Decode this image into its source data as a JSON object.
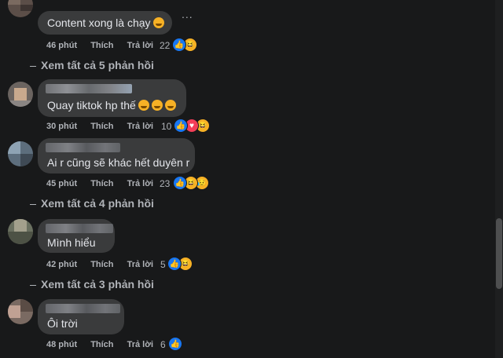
{
  "comments": [
    {
      "text": "Content xong là chạy",
      "emoji": "sweat-smile",
      "time": "46 phút",
      "like": "Thích",
      "reply": "Trả lời",
      "reactions_count": "22",
      "reactions": [
        "like",
        "haha"
      ]
    },
    {
      "text": "Quay tiktok hp thế",
      "emoji": "rofl x3",
      "time": "30 phút",
      "like": "Thích",
      "reply": "Trả lời",
      "reactions_count": "10",
      "reactions": [
        "like",
        "love",
        "haha"
      ]
    },
    {
      "text": "Ai r cũng sẽ khác hết duyên r",
      "time": "45 phút",
      "like": "Thích",
      "reply": "Trả lời",
      "reactions_count": "23",
      "reactions": [
        "like",
        "haha",
        "sad"
      ]
    },
    {
      "text": "Mình hiểu",
      "time": "42 phút",
      "like": "Thích",
      "reply": "Trả lời",
      "reactions_count": "5",
      "reactions": [
        "like",
        "haha"
      ]
    },
    {
      "text": "Ôi trời",
      "time": "48 phút",
      "like": "Thích",
      "reply": "Trả lời",
      "reactions_count": "6",
      "reactions": [
        "like"
      ]
    }
  ],
  "view_replies": [
    "Xem tất cả 5 phản hồi",
    "Xem tất cả 4 phản hồi",
    "Xem tất cả 3 phản hồi"
  ],
  "more_options": "...",
  "colors": {
    "background": "#18191a",
    "bubble": "#3a3b3c",
    "text": "#e4e6eb",
    "secondary": "#b0b3b8",
    "like": "#1877f2",
    "love": "#f33e58",
    "haha": "#f7b125"
  }
}
